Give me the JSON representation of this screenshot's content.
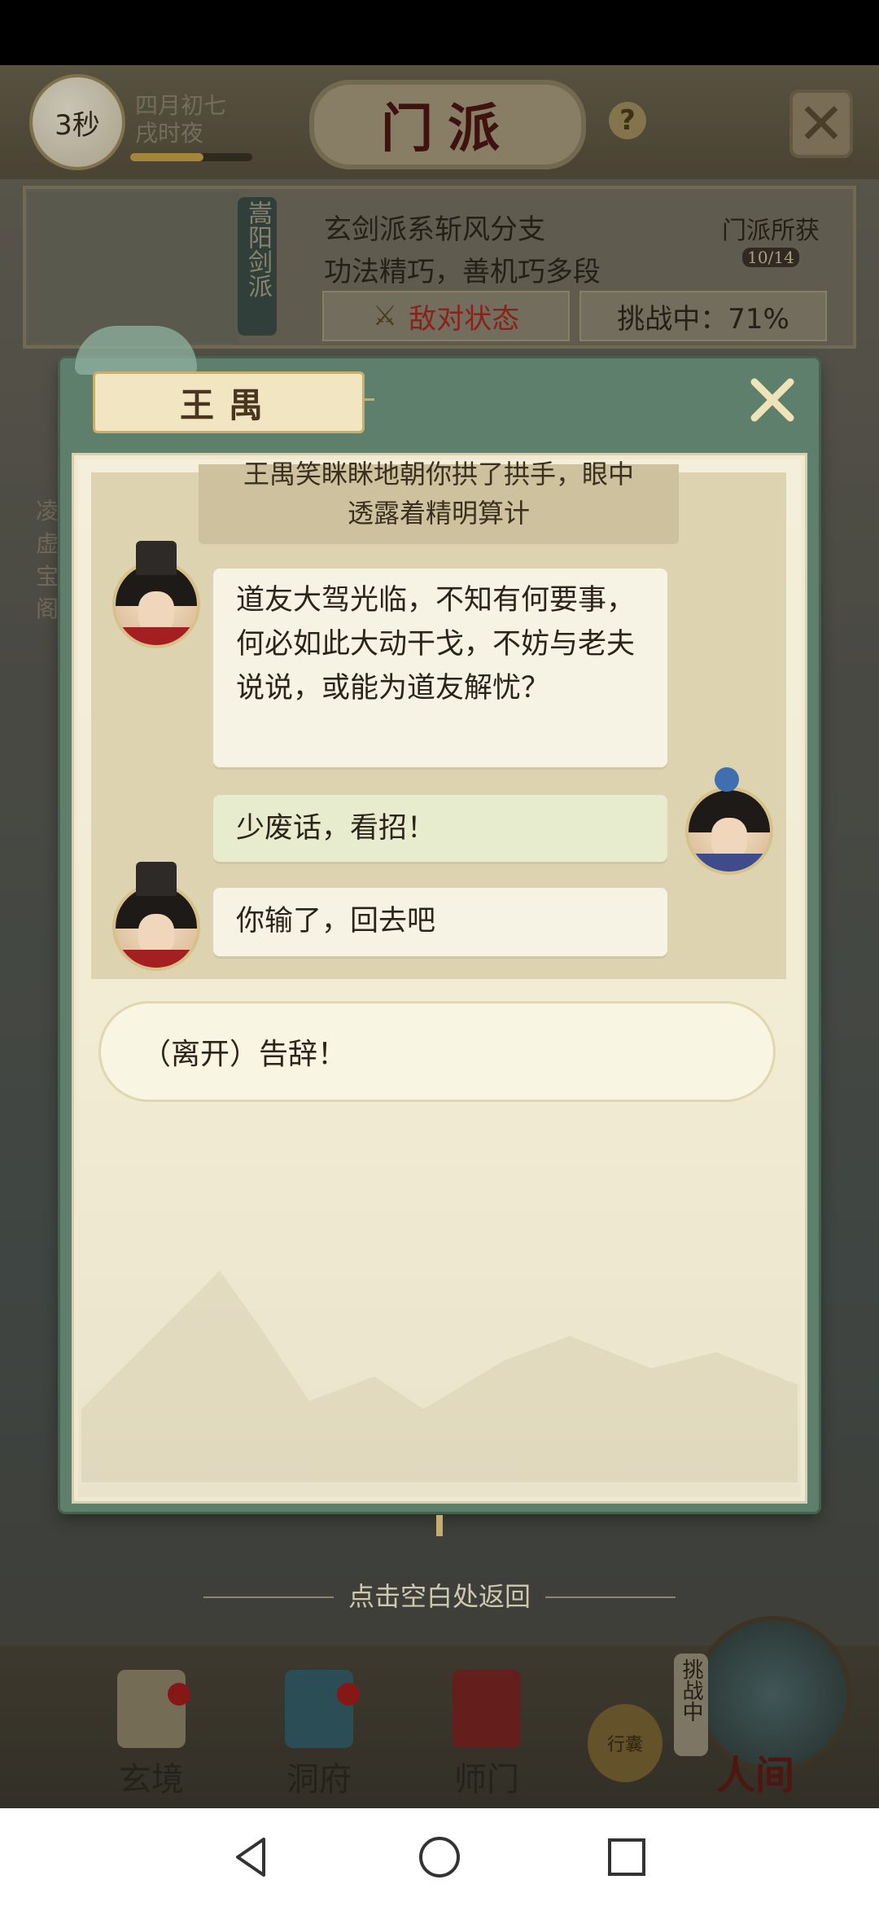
{
  "header": {
    "timer": "3秒",
    "date_line1": "四月初七",
    "date_line2": "戌时夜",
    "day_progress": 0.6,
    "title": "门派",
    "help_label": "?"
  },
  "sect_info": {
    "plaque": "嵩阳剑派",
    "line1": "玄剑派系斩风分支",
    "line2": "功法精巧，善机巧多段",
    "hostile_label": "敌对状态",
    "challenge_label": "挑战中：71%",
    "gains_label": "门派所获",
    "gains_count": "10/14"
  },
  "side_text": "凌虚宝阁",
  "dialog": {
    "npc_name": "王禺",
    "narration_line1": "王禺笑眯眯地朝你拱了拱手，眼中",
    "narration_line2": "透露着精明算计",
    "messages": [
      {
        "speaker": "npc",
        "text": "道友大驾光临，不知有何要事，何必如此大动干戈，不妨与老夫说说，或能为道友解忧？"
      },
      {
        "speaker": "player",
        "text": "少废话，看招！"
      },
      {
        "speaker": "npc",
        "text": "你输了，回去吧"
      }
    ],
    "option": "（离开）告辞！",
    "tap_hint": "点击空白处返回"
  },
  "bottom_nav": {
    "items": [
      "玄境",
      "洞府",
      "师门"
    ],
    "pouch_label": "行囊",
    "challenge_tag": "挑战中",
    "world_label": "人间"
  },
  "colors": {
    "frame_green": "#5d7f6c",
    "paper": "#f4efda",
    "npc_bubble": "#f7f3e4",
    "player_bubble": "#e7ecce",
    "hostile_red": "#a72a22"
  }
}
